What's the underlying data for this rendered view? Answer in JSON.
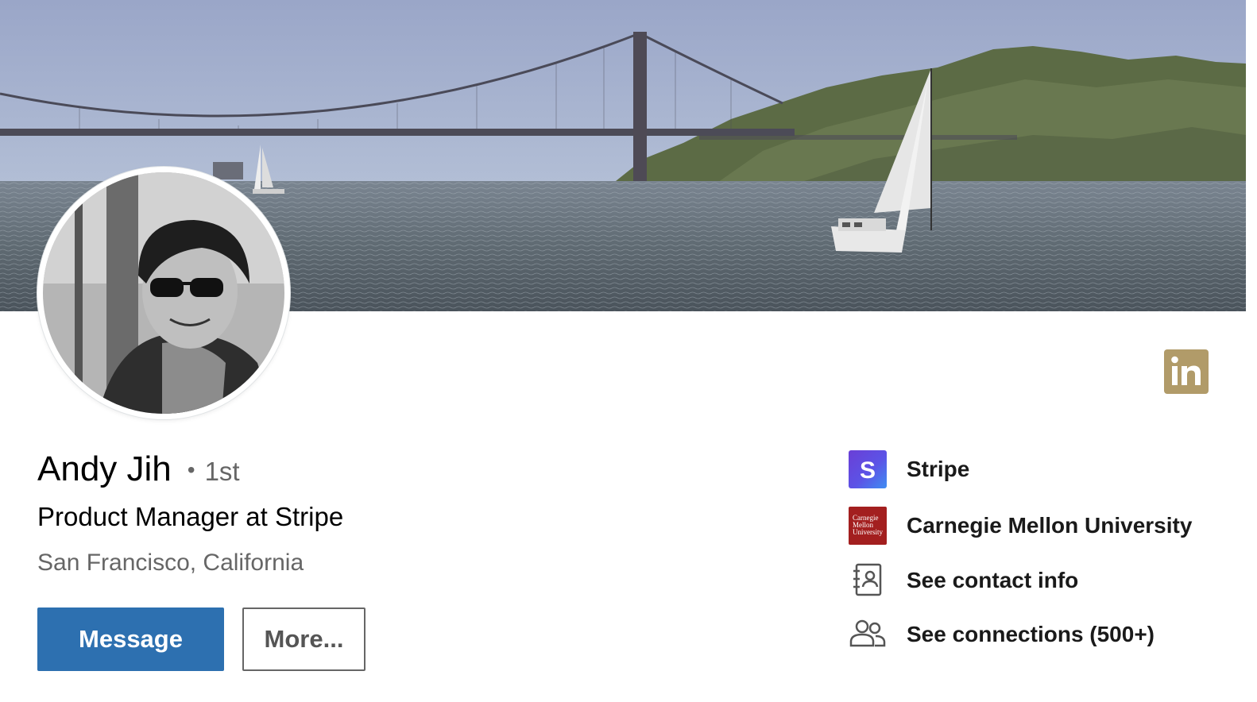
{
  "profile": {
    "name": "Andy Jih",
    "degree_separator": "•",
    "degree": "1st",
    "headline": "Product Manager at Stripe",
    "location": "San Francisco, California"
  },
  "actions": {
    "message_label": "Message",
    "more_label": "More..."
  },
  "sidebar": {
    "items": [
      {
        "label": "Stripe",
        "icon": "stripe-logo",
        "logo_text": "S",
        "color": "#635bff"
      },
      {
        "label": "Carnegie Mellon University",
        "icon": "carnegie-mellon-logo",
        "logo_lines": [
          "Carnegie",
          "Mellon",
          "University"
        ],
        "color": "#a31f1f"
      },
      {
        "label": "See contact info",
        "icon": "contact-card-icon"
      },
      {
        "label": "See connections (500+)",
        "icon": "connections-icon"
      }
    ]
  },
  "badge": {
    "icon": "linkedin-icon",
    "text": "in",
    "color": "#b19b69"
  },
  "colors": {
    "primary_button": "#2d70b0",
    "secondary_text": "#666666"
  }
}
